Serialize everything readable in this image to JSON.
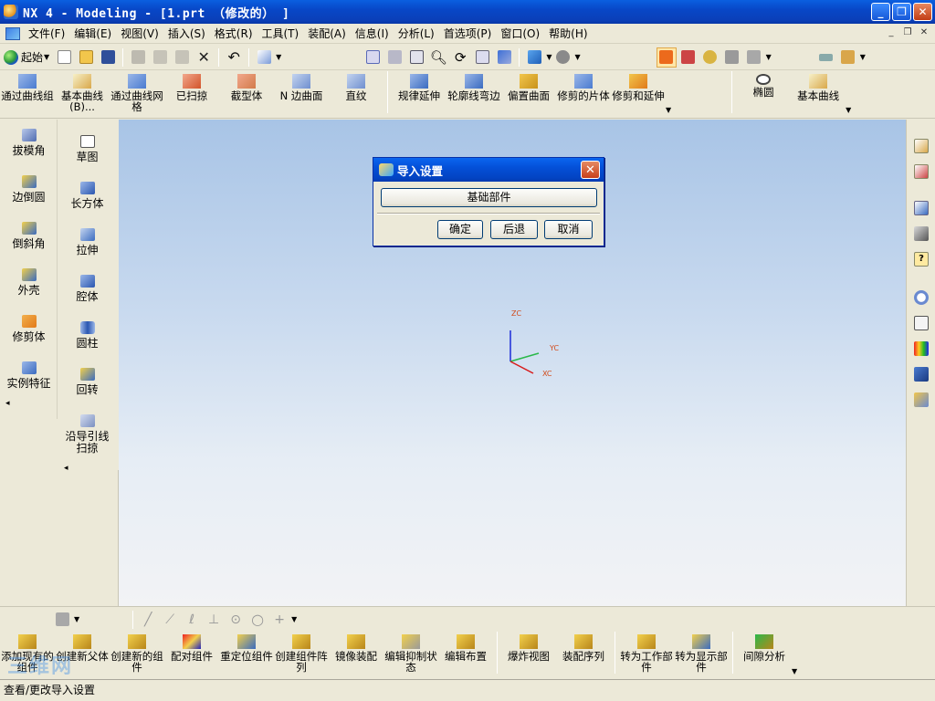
{
  "window": {
    "title": "NX 4 - Modeling - [1.prt （修改的） ]"
  },
  "menu": [
    {
      "label": "文件(F)"
    },
    {
      "label": "编辑(E)"
    },
    {
      "label": "视图(V)"
    },
    {
      "label": "插入(S)"
    },
    {
      "label": "格式(R)"
    },
    {
      "label": "工具(T)"
    },
    {
      "label": "装配(A)"
    },
    {
      "label": "信息(I)"
    },
    {
      "label": "分析(L)"
    },
    {
      "label": "首选项(P)"
    },
    {
      "label": "窗口(O)"
    },
    {
      "label": "帮助(H)"
    }
  ],
  "standard_toolbar": {
    "start_label": "起始"
  },
  "feature_toolbar": [
    {
      "label": "通过曲线组"
    },
    {
      "label": "基本曲线(B)..."
    },
    {
      "label": "通过曲线网格"
    },
    {
      "label": "已扫掠"
    },
    {
      "label": "截型体"
    },
    {
      "label": "N 边曲面"
    },
    {
      "label": "直纹"
    },
    {
      "label": "规律延伸"
    },
    {
      "label": "轮廓线弯边"
    },
    {
      "label": "偏置曲面"
    },
    {
      "label": "修剪的片体"
    },
    {
      "label": "修剪和延伸"
    },
    {
      "label": "椭圆"
    },
    {
      "label": "基本曲线"
    }
  ],
  "left_palette_1": [
    {
      "label": "拔模角"
    },
    {
      "label": "边倒圆"
    },
    {
      "label": "倒斜角"
    },
    {
      "label": "外壳"
    },
    {
      "label": "修剪体"
    },
    {
      "label": "实例特征"
    }
  ],
  "left_palette_2": [
    {
      "label": "草图"
    },
    {
      "label": "长方体"
    },
    {
      "label": "拉伸"
    },
    {
      "label": "腔体"
    },
    {
      "label": "圆柱"
    },
    {
      "label": "回转"
    },
    {
      "label": "沿导引线扫掠"
    }
  ],
  "triad": {
    "zc": "ZC",
    "yc": "YC",
    "xc": "XC"
  },
  "dialog": {
    "title": "导入设置",
    "base_button": "基础部件",
    "ok": "确定",
    "back": "后退",
    "cancel": "取消"
  },
  "assembly_toolbar": [
    {
      "label": "添加现有的组件"
    },
    {
      "label": "创建新父体"
    },
    {
      "label": "创建新的组件"
    },
    {
      "label": "配对组件"
    },
    {
      "label": "重定位组件"
    },
    {
      "label": "创建组件阵列"
    },
    {
      "label": "镜像装配"
    },
    {
      "label": "编辑抑制状态"
    },
    {
      "label": "编辑布置"
    },
    {
      "label": "爆炸视图"
    },
    {
      "label": "装配序列"
    },
    {
      "label": "转为工作部件"
    },
    {
      "label": "转为显示部件"
    },
    {
      "label": "间隙分析"
    }
  ],
  "status": {
    "text": "查看/更改导入设置"
  },
  "watermark": {
    "text": "三维网"
  }
}
